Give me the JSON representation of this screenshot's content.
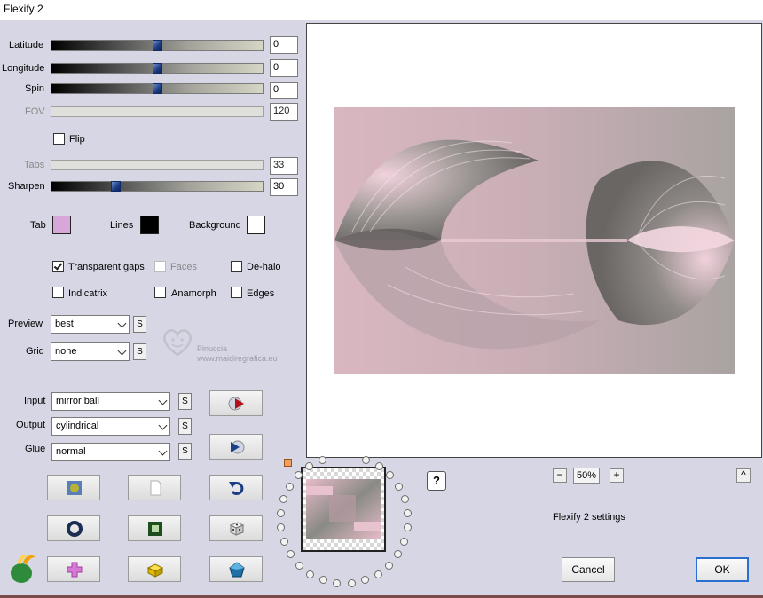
{
  "window": {
    "title": "Flexify 2"
  },
  "sliders": [
    {
      "id": "latitude",
      "label": "Latitude",
      "value": "0",
      "level": 0.5,
      "enabled": true
    },
    {
      "id": "longitude",
      "label": "Longitude",
      "value": "0",
      "level": 0.5,
      "enabled": true
    },
    {
      "id": "spin",
      "label": "Spin",
      "value": "0",
      "level": 0.5,
      "enabled": true
    },
    {
      "id": "fov",
      "label": "FOV",
      "value": "120",
      "enabled": false
    },
    {
      "id": "tabs",
      "label": "Tabs",
      "value": "33",
      "enabled": false
    },
    {
      "id": "sharpen",
      "label": "Sharpen",
      "value": "30",
      "level": 0.3,
      "enabled": true
    }
  ],
  "flip": {
    "label": "Flip",
    "checked": false
  },
  "colors": {
    "tab": {
      "label": "Tab",
      "color": "#d9a6d9"
    },
    "lines": {
      "label": "Lines",
      "color": "#000000"
    },
    "background": {
      "label": "Background",
      "color": "#ffffff"
    }
  },
  "checkboxes": {
    "transparent_gaps": {
      "label": "Transparent gaps",
      "checked": true
    },
    "faces": {
      "label": "Faces",
      "checked": false,
      "enabled": false
    },
    "dehalo": {
      "label": "De-halo",
      "checked": false
    },
    "indicatrix": {
      "label": "Indicatrix",
      "checked": false
    },
    "anamorph": {
      "label": "Anamorph",
      "checked": false
    },
    "edges": {
      "label": "Edges",
      "checked": false
    }
  },
  "selects": {
    "preview": {
      "label": "Preview",
      "value": "best"
    },
    "grid": {
      "label": "Grid",
      "value": "none"
    },
    "input": {
      "label": "Input",
      "value": "mirror ball"
    },
    "output": {
      "label": "Output",
      "value": "cylindrical"
    },
    "glue": {
      "label": "Glue",
      "value": "normal"
    }
  },
  "s_button_label": "S",
  "watermark": {
    "line1": "Pinuccia",
    "line2": "www.maidiregrafica.eu"
  },
  "zoom": {
    "minus": "−",
    "value": "50%",
    "plus": "+"
  },
  "collapse_label": "^",
  "help_label": "?",
  "settings_caption": "Flexify 2 settings",
  "buttons": {
    "cancel": "Cancel",
    "ok": "OK"
  },
  "accent_colors": {
    "preview_pink": "#e6bcc8",
    "preview_grey": "#8a8a85",
    "ok_border": "#2b6fd1"
  }
}
